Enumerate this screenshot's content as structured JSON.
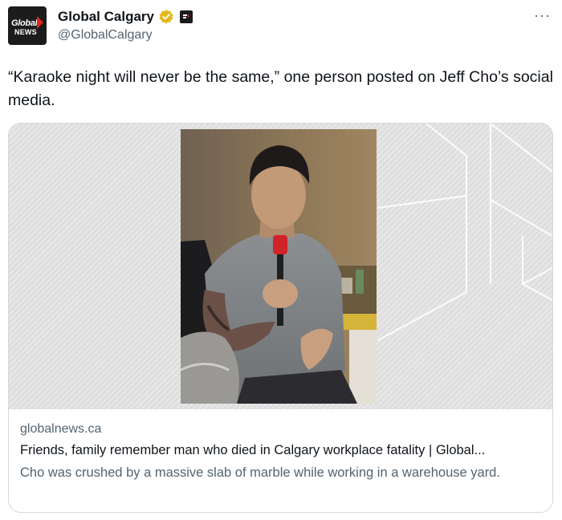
{
  "account": {
    "display_name": "Global Calgary",
    "handle": "@GlobalCalgary",
    "avatar_logo_line1": "Global",
    "avatar_logo_line2": "NEWS",
    "verified_color": "#e2b719",
    "avatar_accent": "#e0261b"
  },
  "menu": {
    "more_label": "···",
    "more_icon": "ellipsis-icon"
  },
  "tweet": {
    "text": "“Karaoke night will never be the same,” one person posted on Jeff Cho’s social media."
  },
  "card": {
    "domain": "globalnews.ca",
    "title": "Friends, family remember man who died in Calgary workplace fatality | Global...",
    "description": "Cho was crushed by a massive slab of marble while working in a warehouse yard."
  }
}
